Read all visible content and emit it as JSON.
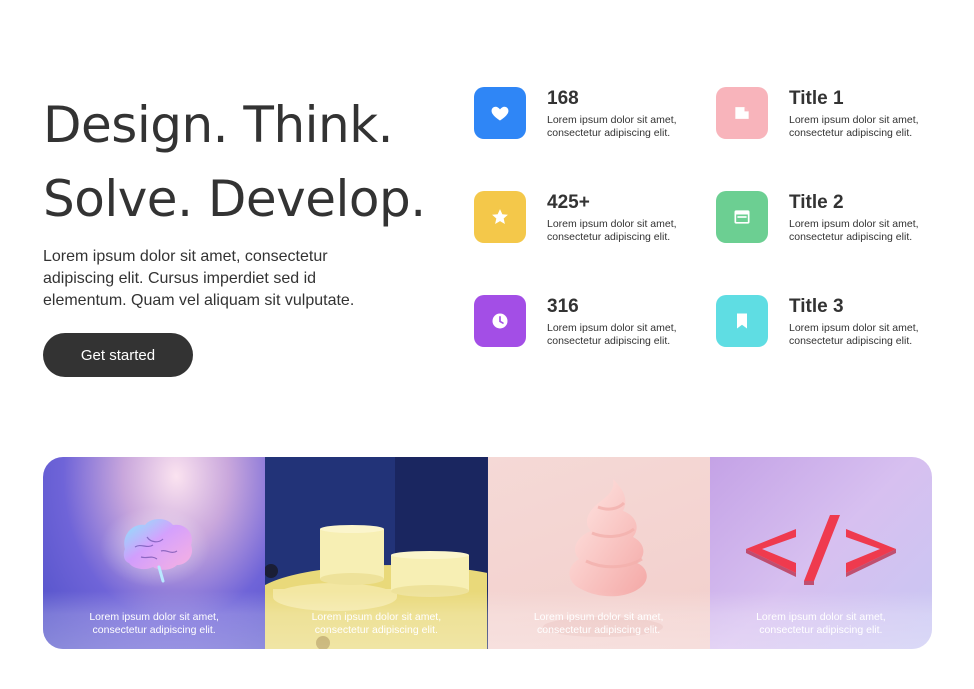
{
  "hero": {
    "title_line1": "Design. Think.",
    "title_line2": "Solve. Develop.",
    "description": "Lorem ipsum dolor sit amet, consectetur adipiscing elit. Cursus imperdiet sed id elementum. Quam vel aliquam sit vulputate.",
    "cta_label": "Get started"
  },
  "features": [
    {
      "title": "168",
      "text": "Lorem ipsum dolor sit amet, consectetur adipiscing elit.",
      "icon": "heart-icon",
      "color": "#2f86f6"
    },
    {
      "title": "Title 1",
      "text": "Lorem ipsum dolor sit amet, consectetur adipiscing elit.",
      "icon": "document-icon",
      "color": "#f8b4bb"
    },
    {
      "title": "425+",
      "text": "Lorem ipsum dolor sit amet, consectetur adipiscing elit.",
      "icon": "star-icon",
      "color": "#f4c84a"
    },
    {
      "title": "Title 2",
      "text": "Lorem ipsum dolor sit amet, consectetur adipiscing elit.",
      "icon": "browser-window-icon",
      "color": "#6ccf92"
    },
    {
      "title": "316",
      "text": "Lorem ipsum dolor sit amet, consectetur adipiscing elit.",
      "icon": "clock-icon",
      "color": "#a34ee6"
    },
    {
      "title": "Title 3",
      "text": "Lorem ipsum dolor sit amet, consectetur adipiscing elit.",
      "icon": "bookmark-icon",
      "color": "#5fdde3"
    }
  ],
  "gallery": [
    {
      "caption": "Lorem ipsum dolor sit amet, consectetur adipiscing elit.",
      "image": "glowing-brain"
    },
    {
      "caption": "Lorem ipsum dolor sit amet, consectetur adipiscing elit.",
      "image": "yellow-podiums"
    },
    {
      "caption": "Lorem ipsum dolor sit amet, consectetur adipiscing elit.",
      "image": "pink-swirl-cream"
    },
    {
      "caption": "Lorem ipsum dolor sit amet, consectetur adipiscing elit.",
      "image": "code-brackets-symbol"
    }
  ]
}
